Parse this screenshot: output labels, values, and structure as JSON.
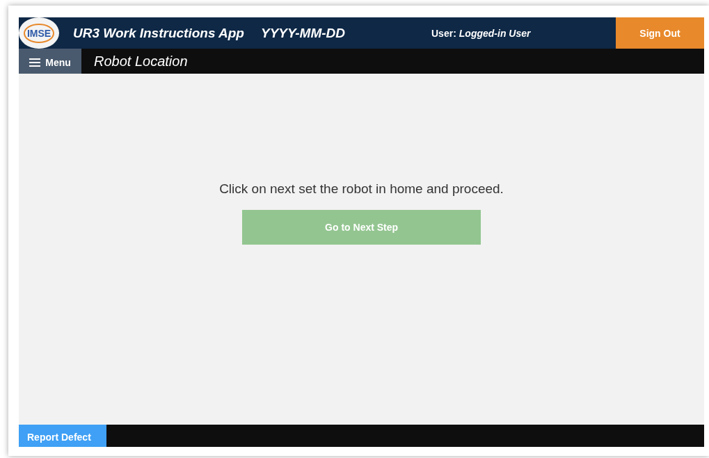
{
  "header": {
    "logo": "IMSE",
    "title": "UR3 Work Instructions App",
    "date": "YYYY-MM-DD",
    "user_label": "User:",
    "user_name": "Logged-in User",
    "sign_out": "Sign Out"
  },
  "subheader": {
    "menu": "Menu",
    "page_title": "Robot Location"
  },
  "content": {
    "message": "Click on next set the robot in home and proceed.",
    "next_button": "Go to Next Step"
  },
  "footer": {
    "report_defect": "Report Defect"
  }
}
